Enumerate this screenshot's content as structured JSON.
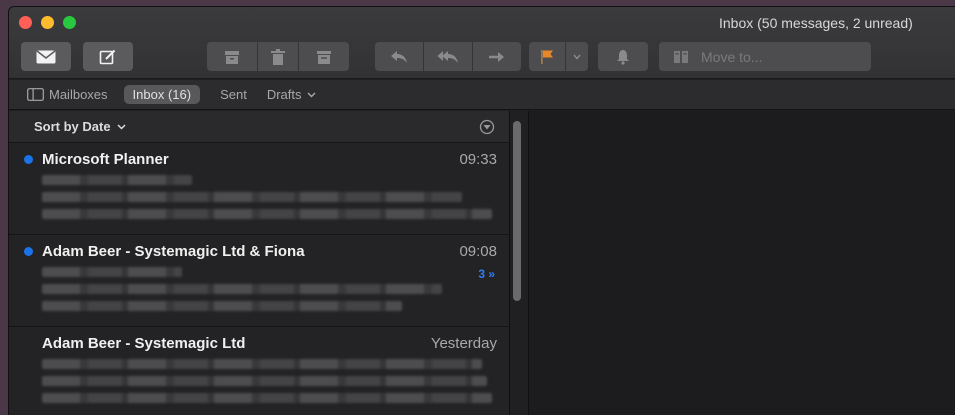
{
  "window": {
    "title": "Inbox (50 messages, 2 unread)"
  },
  "toolbar": {
    "move_to_placeholder": "Move to...",
    "accent_flag": "#e8862a"
  },
  "favorites": {
    "mailboxes_label": "Mailboxes",
    "inbox_label": "Inbox (16)",
    "sent_label": "Sent",
    "drafts_label": "Drafts"
  },
  "list": {
    "sort_label": "Sort by Date",
    "messages": [
      {
        "sender": "Microsoft Planner",
        "time": "09:33",
        "unread": true,
        "thread_count": ""
      },
      {
        "sender": "Adam Beer - Systemagic Ltd & Fiona",
        "time": "09:08",
        "unread": true,
        "thread_count": "3 »"
      },
      {
        "sender": "Adam Beer - Systemagic Ltd",
        "time": "Yesterday",
        "unread": false,
        "thread_count": ""
      }
    ]
  },
  "colors": {
    "unread_dot": "#1a73e8",
    "thread_link": "#2f7ff0"
  }
}
